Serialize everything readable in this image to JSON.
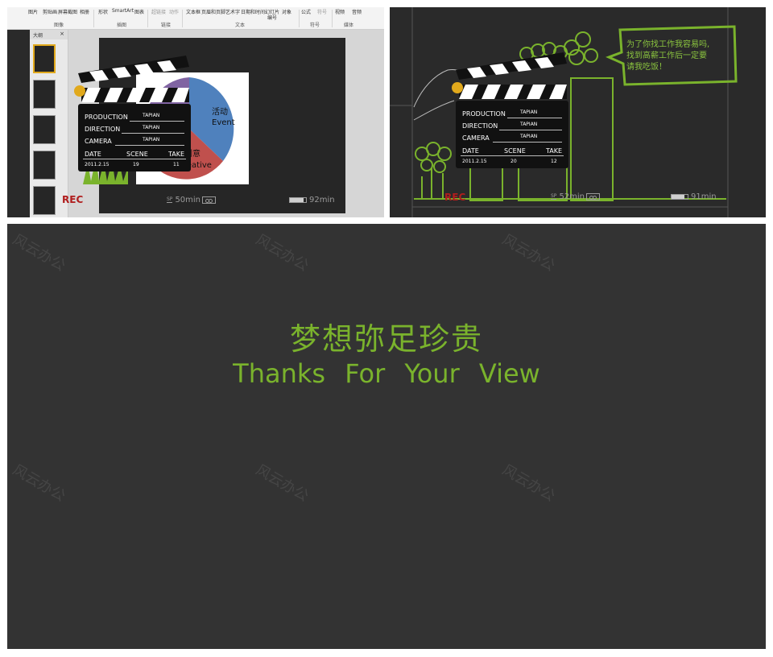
{
  "ribbon": {
    "items": [
      "图片",
      "剪贴画",
      "屏幕截图",
      "相册",
      "形状",
      "SmartArt",
      "图表",
      "超链接",
      "动作",
      "文本框",
      "页眉和页脚",
      "艺术字",
      "日期和时间",
      "幻灯片",
      "对象",
      "公式",
      "符号",
      "视频",
      "音频"
    ],
    "sub_item": "编号",
    "groups": [
      "图像",
      "插图",
      "链接",
      "文本",
      "符号",
      "媒体"
    ]
  },
  "outline": {
    "tab": "大纲",
    "close": "×"
  },
  "chart": {
    "type": "pie",
    "labels": [
      "活动",
      "Event",
      "创意",
      "Creative"
    ],
    "colors": {
      "blue": "#4f81bd",
      "red": "#c0504d",
      "green": "#9bbb59",
      "purple": "#8064a2"
    }
  },
  "clapper_labels": {
    "production": "PRODUCTION",
    "direction": "DIRECTION",
    "camera": "CAMERA",
    "date": "DATE",
    "scene": "SCENE",
    "take": "TAKE",
    "tapian": "TAPIAN"
  },
  "slide1": {
    "date": "2011.2.15",
    "scene": "19",
    "take": "11",
    "rec": "REC",
    "sp": "SP",
    "time_left": "50min",
    "battery": "92min",
    "battery_level": 0.85
  },
  "slide2": {
    "date": "2011.2.15",
    "scene": "20",
    "take": "12",
    "rec": "REC",
    "sp": "SP",
    "time_left": "52min",
    "battery": "91min",
    "battery_level": 0.8,
    "bubble_lines": [
      "为了你找工作我容易吗,",
      "找到高薪工作后一定要",
      "请我吃饭！"
    ]
  },
  "slide3": {
    "title_cn": "梦想弥足珍贵",
    "title_en": "Thanks For  Your View"
  },
  "watermark": "风云办公",
  "colors": {
    "accent_green": "#7ab32c",
    "rec_red": "#b01d1d",
    "slide_bg": "#333333"
  }
}
